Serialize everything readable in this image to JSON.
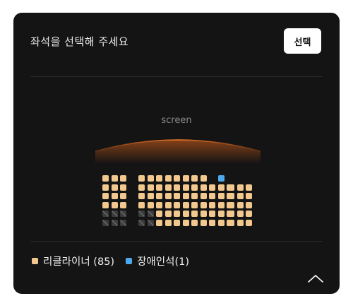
{
  "header": {
    "title": "좌석을 선택해 주세요",
    "select_label": "선택"
  },
  "screen": {
    "label": "screen"
  },
  "seat_map": {
    "left_block": {
      "recliner_rows": 4,
      "recliner_cols": 3,
      "unavailable_rows": 2,
      "unavailable_cols": 3
    },
    "center_block": {
      "top_row": [
        "recliner",
        "recliner",
        "recliner",
        "recliner",
        "recliner",
        "recliner",
        "recliner",
        "recliner",
        "empty",
        "accessible",
        "empty"
      ],
      "row2": [
        "recliner",
        "recliner",
        "recliner",
        "recliner",
        "recliner",
        "recliner",
        "recliner",
        "recliner",
        "recliner",
        "recliner",
        "recliner"
      ],
      "row3": [
        "recliner",
        "recliner",
        "recliner",
        "recliner",
        "recliner",
        "recliner",
        "recliner",
        "recliner",
        "recliner",
        "recliner",
        "recliner"
      ],
      "row4": [
        "recliner",
        "recliner",
        "recliner",
        "recliner",
        "recliner",
        "recliner",
        "recliner",
        "recliner",
        "recliner",
        "recliner",
        "recliner"
      ],
      "row5": [
        "unavailable",
        "unavailable",
        "recliner",
        "recliner",
        "recliner",
        "recliner",
        "recliner",
        "recliner",
        "recliner",
        "recliner",
        "recliner"
      ],
      "row6": [
        "unavailable",
        "unavailable",
        "recliner",
        "recliner",
        "recliner",
        "recliner",
        "recliner",
        "recliner",
        "recliner",
        "recliner",
        "recliner"
      ]
    },
    "right_block": {
      "rows": 5,
      "cols": 3
    }
  },
  "legend": {
    "recliner_label": "리클라이너 (85)",
    "accessible_label": "장애인석(1)"
  },
  "colors": {
    "recliner": "#f2c88e",
    "accessible": "#4da9ec",
    "unavailable": "#3c3c3c",
    "screen_glow": "#e0661c"
  },
  "icons": {
    "collapse": "chevron-up-icon"
  }
}
